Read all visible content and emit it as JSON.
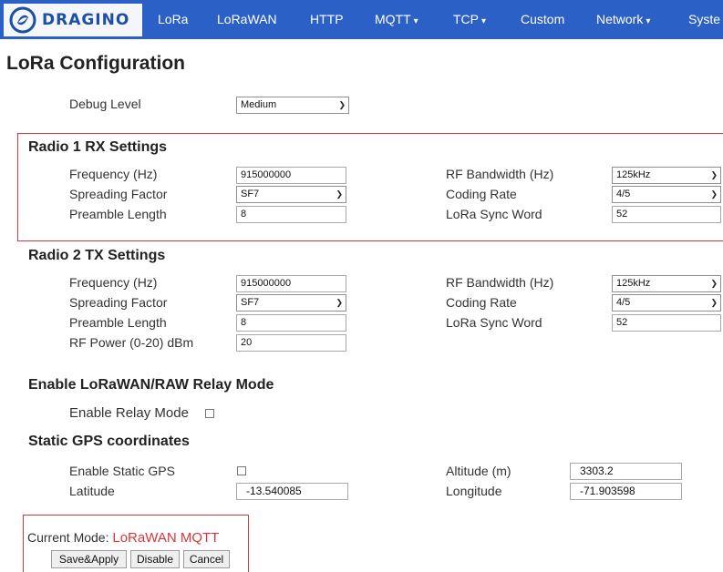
{
  "nav": {
    "brand": "DRAGINO",
    "items": [
      "LoRa",
      "LoRaWAN",
      "HTTP",
      "MQTT",
      "TCP",
      "Custom",
      "Network",
      "Syste"
    ],
    "dropdown_caret": "▾"
  },
  "page": {
    "title": "LoRa Configuration"
  },
  "debug": {
    "label": "Debug Level",
    "value": "Medium"
  },
  "radio1": {
    "title": "Radio 1 RX Settings",
    "frequency_label": "Frequency (Hz)",
    "frequency": "915000000",
    "sf_label": "Spreading Factor",
    "sf": "SF7",
    "preamble_label": "Preamble Length",
    "preamble": "8",
    "bw_label": "RF Bandwidth (Hz)",
    "bw": "125kHz",
    "cr_label": "Coding Rate",
    "cr": "4/5",
    "sync_label": "LoRa Sync Word",
    "sync": "52"
  },
  "radio2": {
    "title": "Radio 2 TX Settings",
    "frequency_label": "Frequency (Hz)",
    "frequency": "915000000",
    "sf_label": "Spreading Factor",
    "sf": "SF7",
    "preamble_label": "Preamble Length",
    "preamble": "8",
    "power_label": "RF Power (0-20) dBm",
    "power": "20",
    "bw_label": "RF Bandwidth (Hz)",
    "bw": "125kHz",
    "cr_label": "Coding Rate",
    "cr": "4/5",
    "sync_label": "LoRa Sync Word",
    "sync": "52"
  },
  "relay": {
    "title": "Enable LoRaWAN/RAW Relay Mode",
    "label": "Enable Relay Mode"
  },
  "gps": {
    "title": "Static GPS coordinates",
    "enable_label": "Enable Static GPS",
    "latitude_label": "Latitude",
    "latitude": "-13.540085",
    "altitude_label": "Altitude (m)",
    "altitude": "3303.2",
    "longitude_label": "Longitude",
    "longitude": "-71.903598"
  },
  "status": {
    "mode_label": "Current Mode:",
    "mode_value": "LoRaWAN MQTT"
  },
  "buttons": {
    "save": "Save&Apply",
    "disable": "Disable",
    "cancel": "Cancel"
  },
  "colors": {
    "nav_bg": "#2b61c7",
    "highlight": "#d9383a",
    "brand_text": "#1b4fa8"
  }
}
